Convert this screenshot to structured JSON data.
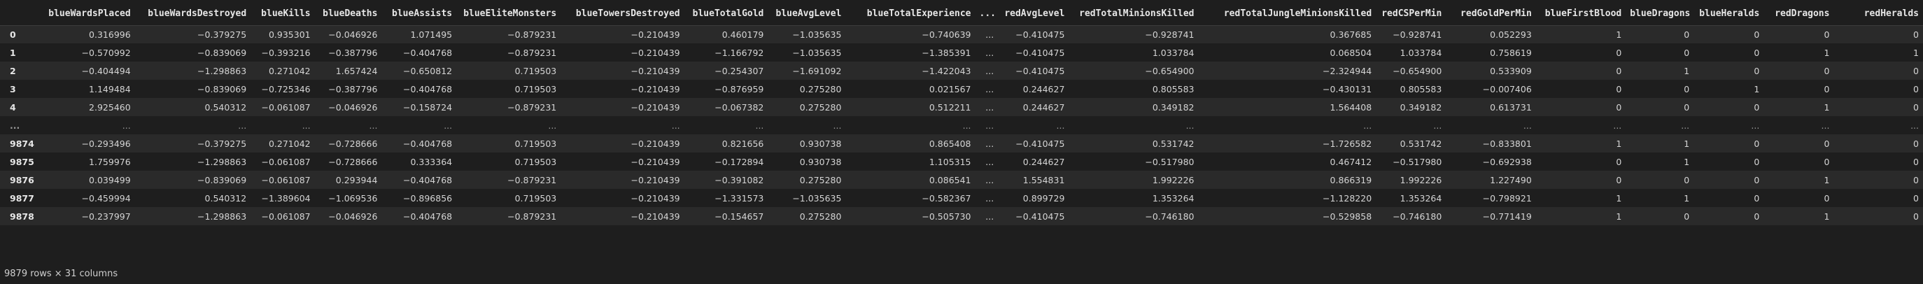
{
  "dataframe": {
    "columns": [
      "",
      "blueWardsPlaced",
      "blueWardsDestroyed",
      "blueKills",
      "blueDeaths",
      "blueAssists",
      "blueEliteMonsters",
      "blueTowersDestroyed",
      "blueTotalGold",
      "blueAvgLevel",
      "blueTotalExperience",
      "...",
      "redAvgLevel",
      "redTotalMinionsKilled",
      "redTotalJungleMinionsKilled",
      "redCSPerMin",
      "redGoldPerMin",
      "blueFirstBlood",
      "blueDragons",
      "blueHeralds",
      "redDragons",
      "redHeralds"
    ],
    "rows": [
      [
        "0",
        "0.316996",
        "−0.379275",
        "0.935301",
        "−0.046926",
        "1.071495",
        "−0.879231",
        "−0.210439",
        "0.460179",
        "−1.035635",
        "−0.740639",
        "...",
        "−0.410475",
        "−0.928741",
        "0.367685",
        "−0.928741",
        "0.052293",
        "1",
        "0",
        "0",
        "0",
        "0"
      ],
      [
        "1",
        "−0.570992",
        "−0.839069",
        "−0.393216",
        "−0.387796",
        "−0.404768",
        "−0.879231",
        "−0.210439",
        "−1.166792",
        "−1.035635",
        "−1.385391",
        "...",
        "−0.410475",
        "1.033784",
        "0.068504",
        "1.033784",
        "0.758619",
        "0",
        "0",
        "0",
        "1",
        "1"
      ],
      [
        "2",
        "−0.404494",
        "−1.298863",
        "0.271042",
        "1.657424",
        "−0.650812",
        "0.719503",
        "−0.210439",
        "−0.254307",
        "−1.691092",
        "−1.422043",
        "...",
        "−0.410475",
        "−0.654900",
        "−2.324944",
        "−0.654900",
        "0.533909",
        "0",
        "1",
        "0",
        "0",
        "0"
      ],
      [
        "3",
        "1.149484",
        "−0.839069",
        "−0.725346",
        "−0.387796",
        "−0.404768",
        "0.719503",
        "−0.210439",
        "−0.876959",
        "0.275280",
        "0.021567",
        "...",
        "0.244627",
        "0.805583",
        "−0.430131",
        "0.805583",
        "−0.007406",
        "0",
        "0",
        "1",
        "0",
        "0"
      ],
      [
        "4",
        "2.925460",
        "0.540312",
        "−0.061087",
        "−0.046926",
        "−0.158724",
        "−0.879231",
        "−0.210439",
        "−0.067382",
        "0.275280",
        "0.512211",
        "...",
        "0.244627",
        "0.349182",
        "1.564408",
        "0.349182",
        "0.613731",
        "0",
        "0",
        "0",
        "1",
        "0"
      ],
      [
        "...",
        "...",
        "...",
        "...",
        "...",
        "...",
        "...",
        "...",
        "...",
        "...",
        "...",
        "...",
        "...",
        "...",
        "...",
        "...",
        "...",
        "...",
        "...",
        "...",
        "...",
        "..."
      ],
      [
        "9874",
        "−0.293496",
        "−0.379275",
        "0.271042",
        "−0.728666",
        "−0.404768",
        "0.719503",
        "−0.210439",
        "0.821656",
        "0.930738",
        "0.865408",
        "...",
        "−0.410475",
        "0.531742",
        "−1.726582",
        "0.531742",
        "−0.833801",
        "1",
        "1",
        "0",
        "0",
        "0"
      ],
      [
        "9875",
        "1.759976",
        "−1.298863",
        "−0.061087",
        "−0.728666",
        "0.333364",
        "0.719503",
        "−0.210439",
        "−0.172894",
        "0.930738",
        "1.105315",
        "...",
        "0.244627",
        "−0.517980",
        "0.467412",
        "−0.517980",
        "−0.692938",
        "0",
        "1",
        "0",
        "0",
        "0"
      ],
      [
        "9876",
        "0.039499",
        "−0.839069",
        "−0.061087",
        "0.293944",
        "−0.404768",
        "−0.879231",
        "−0.210439",
        "−0.391082",
        "0.275280",
        "0.086541",
        "...",
        "1.554831",
        "1.992226",
        "0.866319",
        "1.992226",
        "1.227490",
        "0",
        "0",
        "0",
        "1",
        "0"
      ],
      [
        "9877",
        "−0.459994",
        "0.540312",
        "−1.389604",
        "−1.069536",
        "−0.896856",
        "0.719503",
        "−0.210439",
        "−1.331573",
        "−1.035635",
        "−0.582367",
        "...",
        "0.899729",
        "1.353264",
        "−1.128220",
        "1.353264",
        "−0.798921",
        "1",
        "1",
        "0",
        "0",
        "0"
      ],
      [
        "9878",
        "−0.237997",
        "−1.298863",
        "−0.061087",
        "−0.046926",
        "−0.404768",
        "−0.879231",
        "−0.210439",
        "−0.154657",
        "0.275280",
        "−0.505730",
        "...",
        "−0.410475",
        "−0.746180",
        "−0.529858",
        "−0.746180",
        "−0.771419",
        "1",
        "0",
        "0",
        "1",
        "0"
      ]
    ]
  },
  "footer": {
    "shape_text": "9879 rows × 31 columns"
  },
  "colors": {
    "background": "#1e1e1e",
    "row_alt": "#2a2a2a",
    "text": "#d4d4d4"
  }
}
